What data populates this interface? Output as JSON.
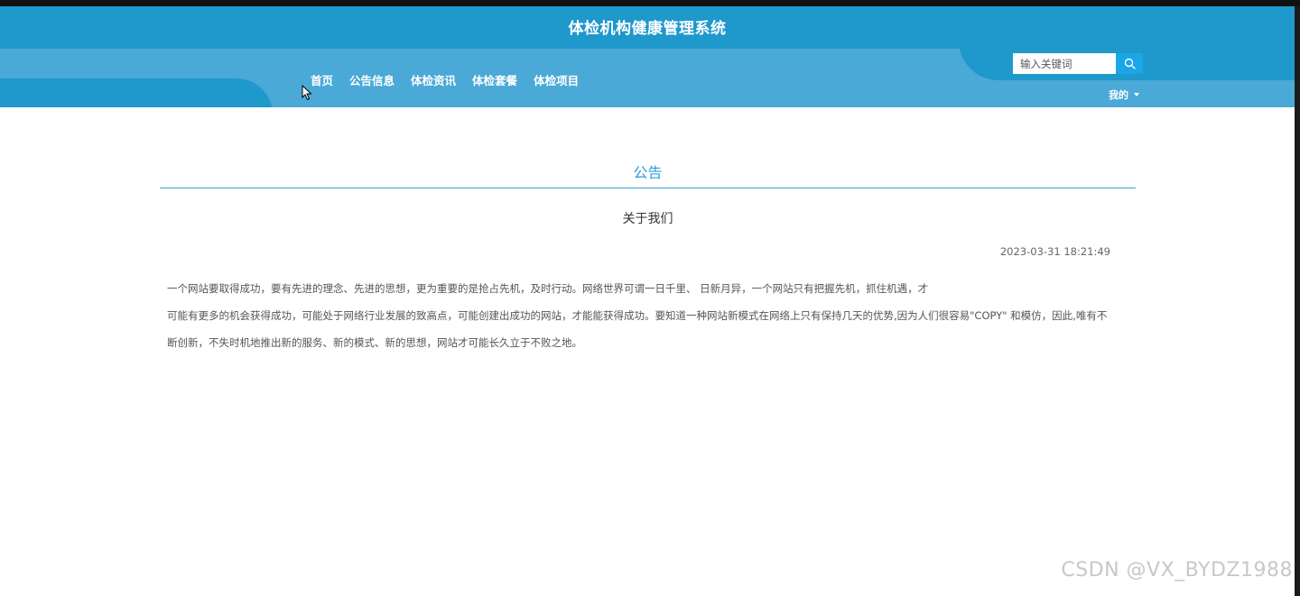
{
  "app": {
    "title": "体检机构健康管理系统"
  },
  "nav": {
    "items": [
      "首页",
      "公告信息",
      "体检资讯",
      "体检套餐",
      "体检项目"
    ]
  },
  "search": {
    "placeholder": "输入关键词",
    "icon": "search-icon"
  },
  "user_menu": {
    "label": "我的",
    "icon": "caret-down-icon"
  },
  "section": {
    "title": "公告"
  },
  "article": {
    "title": "关于我们",
    "date": "2023-03-31 18:21:49",
    "paragraphs": [
      "一个网站要取得成功，要有先进的理念、先进的思想，更为重要的是抢占先机，及时行动。网络世界可谓一日千里、 日新月异，一个网站只有把握先机，抓住机遇，才",
      "可能有更多的机会获得成功，可能处于网络行业发展的致高点，可能创建出成功的网站，才能能获得成功。要知道一种网站新模式在网络上只有保持几天的优势,因为人们很容易\"COPY\" 和模仿，因此,唯有不",
      "断创新，不失时机地推出新的服务、新的模式、新的思想，网站才可能长久立于不败之地。"
    ]
  },
  "watermark": "CSDN @VX_BYDZ1988",
  "colors": {
    "header_dark": "#1f98cc",
    "header_light": "#4aa9d6",
    "accent": "#2aa0d8",
    "search_button": "#1ba6e6"
  }
}
